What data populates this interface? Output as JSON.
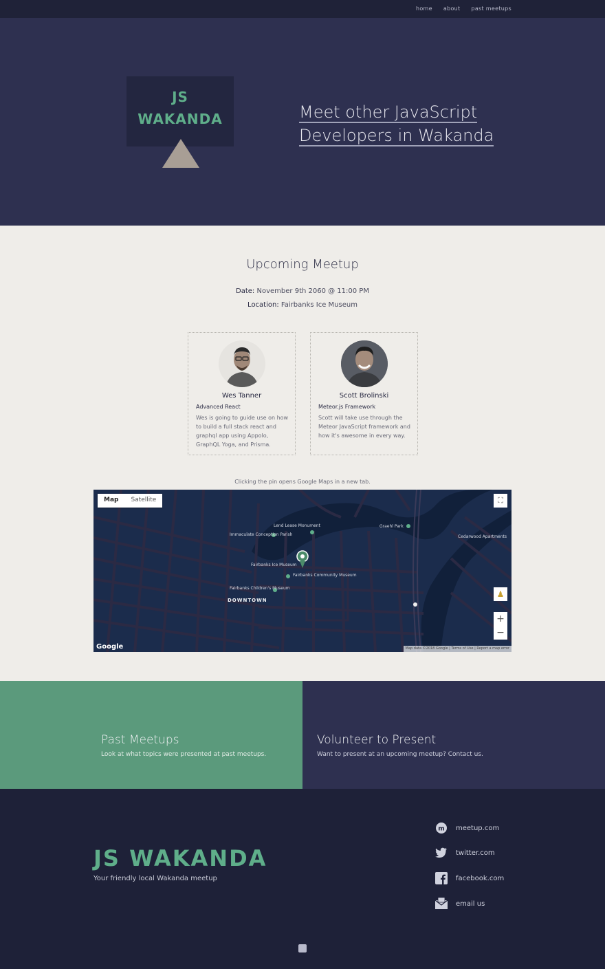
{
  "nav": {
    "items": [
      "home",
      "about",
      "past meetups"
    ]
  },
  "hero": {
    "logo_line1": "JS",
    "logo_line2": "WAKANDA",
    "title_line1": "Meet other JavaScript",
    "title_line2": "Developers in Wakanda"
  },
  "meetup": {
    "title": "Upcoming Meetup",
    "date_label": "Date:",
    "date_value": "November 9th 2060 @ 11:00 PM",
    "location_label": "Location:",
    "location_value": "Fairbanks Ice Museum",
    "speakers": [
      {
        "name": "Wes Tanner",
        "topic": "Advanced React",
        "description": "Wes is going to guide use on how to build a full stack react and graphql app using Appolo, GraphQL Yoga, and Prisma."
      },
      {
        "name": "Scott Brolinski",
        "topic": "Meteor.js Framework",
        "description": "Scott will take use through the Meteor JavaScript framework and how it's awesome in every way."
      }
    ]
  },
  "map": {
    "note": "Clicking the pin opens Google Maps in a new tab.",
    "tab_map": "Map",
    "tab_satellite": "Satellite",
    "google": "Google",
    "attribution": "Map data ©2018 Google | Terms of Use | Report a map error",
    "labels": {
      "lend_lease": "Lend Lease Monument",
      "immaculate": "Immaculate Conception Parish",
      "gralh_park": "Graehl Park",
      "cedarwood": "Cedarwood Apartments",
      "ice_museum": "Fairbanks Ice Museum",
      "community_museum": "Fairbanks Community Museum",
      "childrens_museum": "Fairbanks Children's Museum",
      "downtown": "DOWNTOWN"
    }
  },
  "panels": {
    "past_title": "Past Meetups",
    "past_sub": "Look at what topics were presented at past meetups.",
    "vol_title": "Volunteer to Present",
    "vol_sub": "Want to present at an upcoming meetup? Contact us."
  },
  "footer": {
    "logo": "JS WAKANDA",
    "tagline": "Your friendly local Wakanda meetup",
    "links": [
      "meetup.com",
      "twitter.com",
      "facebook.com",
      "email us"
    ]
  },
  "colors": {
    "accent_green": "#5fae8a",
    "hero_bg": "#2e3050",
    "footer_bg": "#1e2138",
    "panel_green": "#5b9a7c"
  }
}
